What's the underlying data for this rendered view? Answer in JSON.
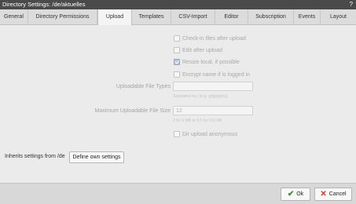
{
  "window": {
    "title": "Directory Settings: /de/aktuelles",
    "help_label": "?"
  },
  "tabs": [
    {
      "label": "General"
    },
    {
      "label": "Directory Permissions"
    },
    {
      "label": "Upload"
    },
    {
      "label": "Templates"
    },
    {
      "label": "CSV-Import"
    },
    {
      "label": "Editor"
    },
    {
      "label": "Subscription"
    },
    {
      "label": "Events"
    },
    {
      "label": "Layout"
    }
  ],
  "active_tab": "Upload",
  "upload": {
    "options": [
      {
        "label": "Check-in files after upload",
        "checked": false
      },
      {
        "label": "Edit after upload",
        "checked": false
      },
      {
        "label": "Resize local, if possible",
        "checked": true
      },
      {
        "label": "Encrypt name if is logged in",
        "checked": false
      }
    ],
    "file_types": {
      "label": "Uploadable File Types",
      "value": "",
      "hint": "Separated by | (e.g. gif|jpg|png)"
    },
    "max_size": {
      "label": "Maximum Uploadable File Size",
      "value": "12",
      "hint": "2 for 2 MB or 0.5 for 512 KB"
    },
    "anonymous": {
      "label": "Dir upload anonymous",
      "checked": false
    }
  },
  "inherit": {
    "label": "Inherits settings from  /de",
    "button": "Define own settings"
  },
  "footer": {
    "ok_label": "Ok",
    "cancel_label": "Cancel"
  },
  "colors": {
    "titlebar": "#4a4a4a",
    "ok_icon": "#3a8f2a",
    "cancel_icon": "#d23a2a"
  }
}
